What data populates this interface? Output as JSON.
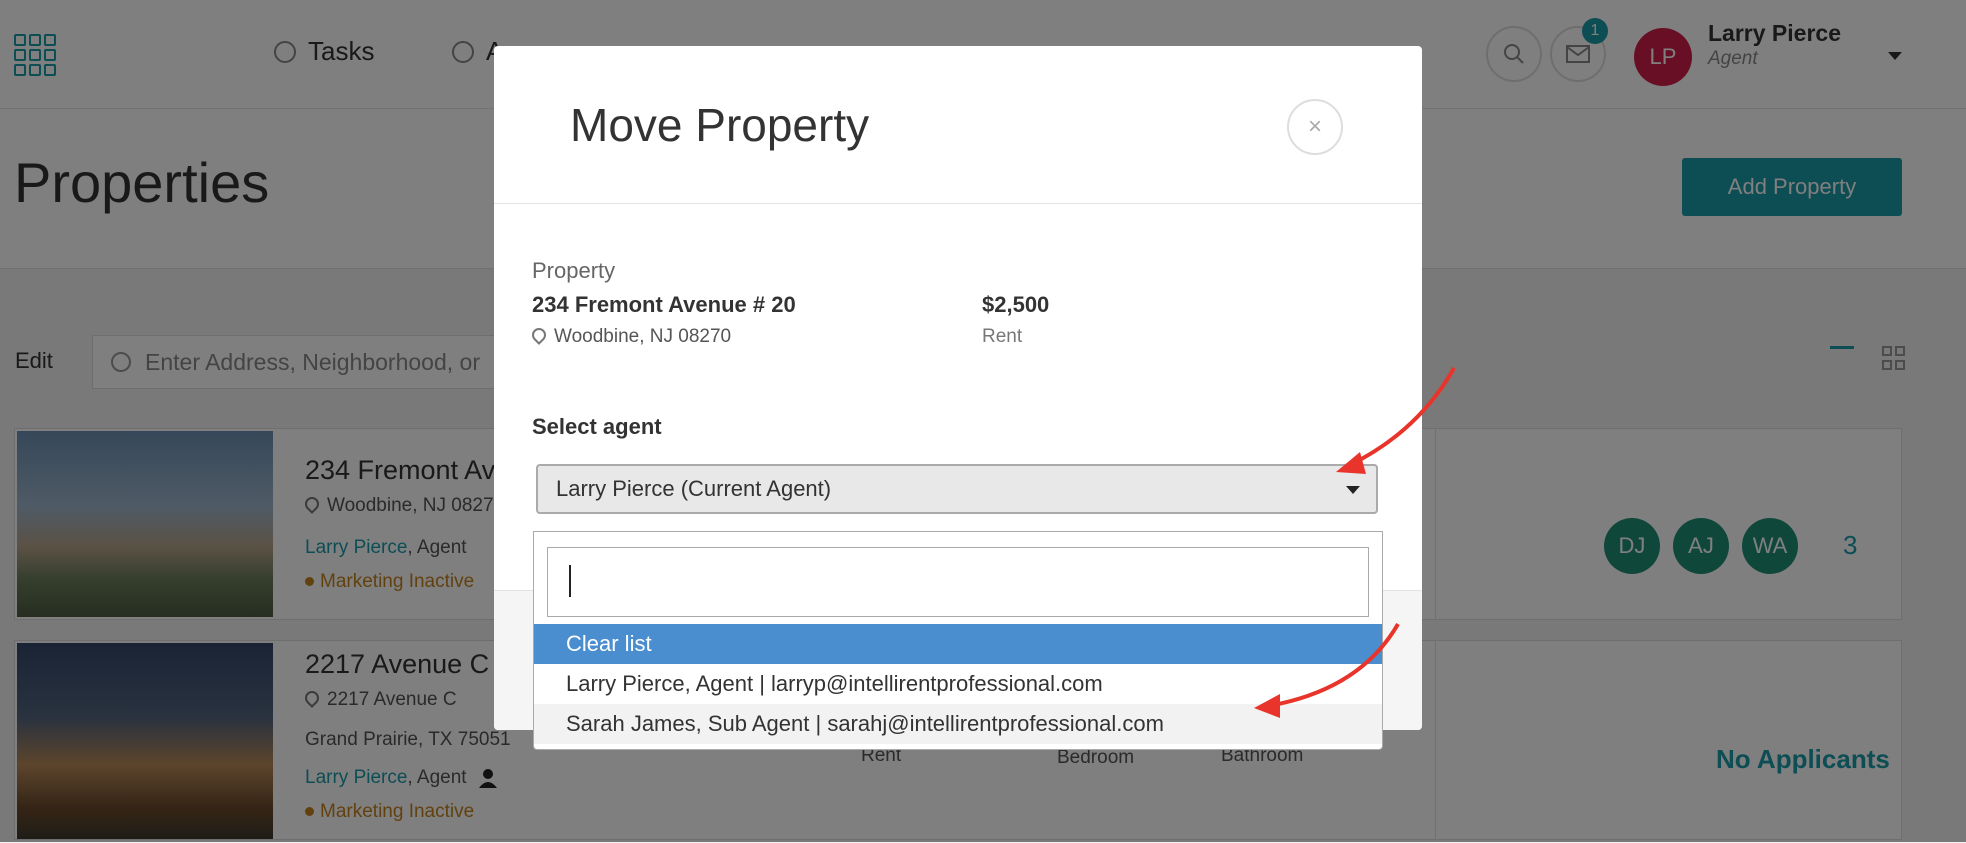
{
  "header": {
    "nav": [
      "Tasks",
      "Ap",
      "",
      ""
    ],
    "notification_count": "1",
    "avatar_initials": "LP",
    "user_name": "Larry Pierce",
    "user_role": "Agent"
  },
  "page": {
    "title": "Properties",
    "add_button": "Add Property",
    "edit_label": "Edit",
    "search_placeholder": "Enter Address, Neighborhood, or"
  },
  "cards": [
    {
      "title": "234 Fremont Av",
      "location": "Woodbine, NJ 0827",
      "agent_name": "Larry Pierce",
      "agent_role": ", Agent",
      "status": "Marketing Inactive",
      "applicants": [
        "DJ",
        "AJ",
        "WA"
      ],
      "applicant_count": "3"
    },
    {
      "title": "2217 Avenue C",
      "address_line": "2217 Avenue C",
      "city": "Grand Prairie, TX 75051",
      "agent_name": "Larry Pierce",
      "agent_role": ", Agent",
      "status": "Marketing Inactive",
      "col_rent": "Rent",
      "col_bedroom": "Bedroom",
      "col_bathroom": "Bathroom",
      "no_applicants": "No Applicants"
    }
  ],
  "modal": {
    "title": "Move Property",
    "close_symbol": "×",
    "property_label": "Property",
    "property_address": "234 Fremont Avenue # 20",
    "property_location": "Woodbine, NJ 08270",
    "property_price": "$2,500",
    "property_type": "Rent",
    "select_label": "Select agent",
    "selected_agent": "Larry Pierce (Current Agent)"
  },
  "dropdown": {
    "search_value": "",
    "options": [
      "Clear list",
      "Larry Pierce, Agent | larryp@intellirentprofessional.com",
      "Sarah James, Sub Agent | sarahj@intellirentprofessional.com"
    ],
    "highlighted_option": "Clear list"
  },
  "colors": {
    "brand": "#1a9aa8",
    "highlight": "#4a8ed0",
    "annotation_arrow": "#e8342a",
    "status_warning": "#c4821f"
  }
}
